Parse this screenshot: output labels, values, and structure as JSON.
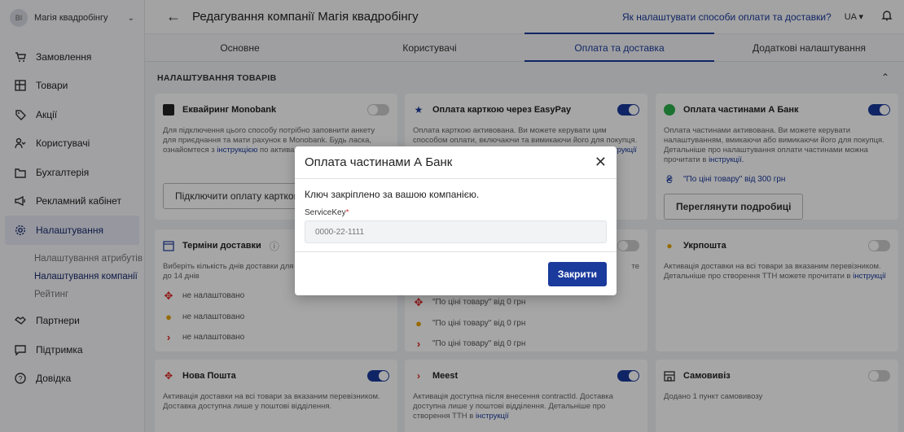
{
  "sidebar": {
    "avatar": "BI",
    "company": "Магія квадробінгу",
    "items": [
      {
        "label": "Замовлення",
        "icon": "cart-icon"
      },
      {
        "label": "Товари",
        "icon": "boxes-icon"
      },
      {
        "label": "Акції",
        "icon": "tag-icon"
      },
      {
        "label": "Користувачі",
        "icon": "users-icon"
      },
      {
        "label": "Бухгалтерія",
        "icon": "folder-icon"
      },
      {
        "label": "Рекламний кабінет",
        "icon": "megaphone-icon"
      },
      {
        "label": "Налаштування",
        "icon": "gear-icon"
      }
    ],
    "subitems": [
      {
        "label": "Налаштування атрибутів"
      },
      {
        "label": "Налаштування компанії"
      },
      {
        "label": "Рейтинг"
      }
    ],
    "bottom_items": [
      {
        "label": "Партнери",
        "icon": "handshake-icon"
      },
      {
        "label": "Підтримка",
        "icon": "chat-icon"
      },
      {
        "label": "Довідка",
        "icon": "help-icon"
      }
    ]
  },
  "header": {
    "title": "Редагування компанії Магія квадробінгу",
    "help_link": "Як налаштувати способи оплати та доставки?",
    "lang": "UA"
  },
  "tabs": [
    {
      "label": "Основне"
    },
    {
      "label": "Користувачі"
    },
    {
      "label": "Оплата та доставка"
    },
    {
      "label": "Додаткові налаштування"
    }
  ],
  "section": {
    "title": "НАЛАШТУВАННЯ ТОВАРІВ"
  },
  "cards": {
    "monobank": {
      "title": "Еквайринг Monobank",
      "desc": "Для підключення цього способу потрібно заповнити анкету для приєднання та мати рахунок в Monobank. Будь ласка, ознайомтеся з",
      "link": "інструкцією",
      "desc2": "по активації даного способу.",
      "button": "Підключити оплату карткою"
    },
    "easypay": {
      "title": "Оплата карткою через EasyPay",
      "desc": "Оплата карткою активована. Ви можете керувати цим способом оплати, включаючи та вимикаючи його для покупця. Детальніше про оплату карткою можете прочитати в",
      "link": "інструкції"
    },
    "abank": {
      "title": "Оплата частинами А Банк",
      "desc": "Оплата частинами активована. Ви можете керувати налаштуванням, вмикаючи або вимикаючи його для покупця. Детальніше про налаштування оплати частинами можна прочитати в",
      "link": "інструкції.",
      "price_rule": "\"По ціні товару\" від 300 грн",
      "button": "Переглянути подробиці"
    },
    "terms": {
      "title": "Терміни доставки",
      "desc": "Виберіть кількість днів доставки для кожного перевізника від 1 до 14 днів",
      "rows": [
        "не налаштовано",
        "не налаштовано",
        "не налаштовано"
      ]
    },
    "middle": {
      "tail": "те",
      "rows": [
        "\"По ціні товару\" від 0 грн",
        "\"По ціні товару\" від 0 грн",
        "\"По ціні товару\" від 0 грн"
      ]
    },
    "ukrposhta": {
      "title": "Укрпошта",
      "desc": "Активація доставки на всі товари за вказаним перевізником. Детальніше про створення ТТН можете прочитати в",
      "link": "інструкції"
    },
    "novaposhta": {
      "title": "Нова Пошта",
      "desc": "Активація доставки на всі товари за вказаним перевізником. Доставка доступна лише у поштові відділення."
    },
    "meest": {
      "title": "Meest",
      "desc": "Активація доступна після внесення contractId. Доставка доступна лише у поштові відділення. Детальніше про створення ТТН в",
      "link": "інструкції"
    },
    "pickup": {
      "title": "Самовивіз",
      "desc": "Додано 1 пункт самовивозу"
    }
  },
  "modal": {
    "title": "Оплата частинами А Банк",
    "message": "Ключ закріплено за вашою компанією.",
    "field_label": "ServiceKey",
    "required_mark": "*",
    "field_placeholder": "0000-22-1111",
    "close_button": "Закрити"
  },
  "colors": {
    "accent": "#1a3a9c",
    "background": "#f0f1f5"
  }
}
